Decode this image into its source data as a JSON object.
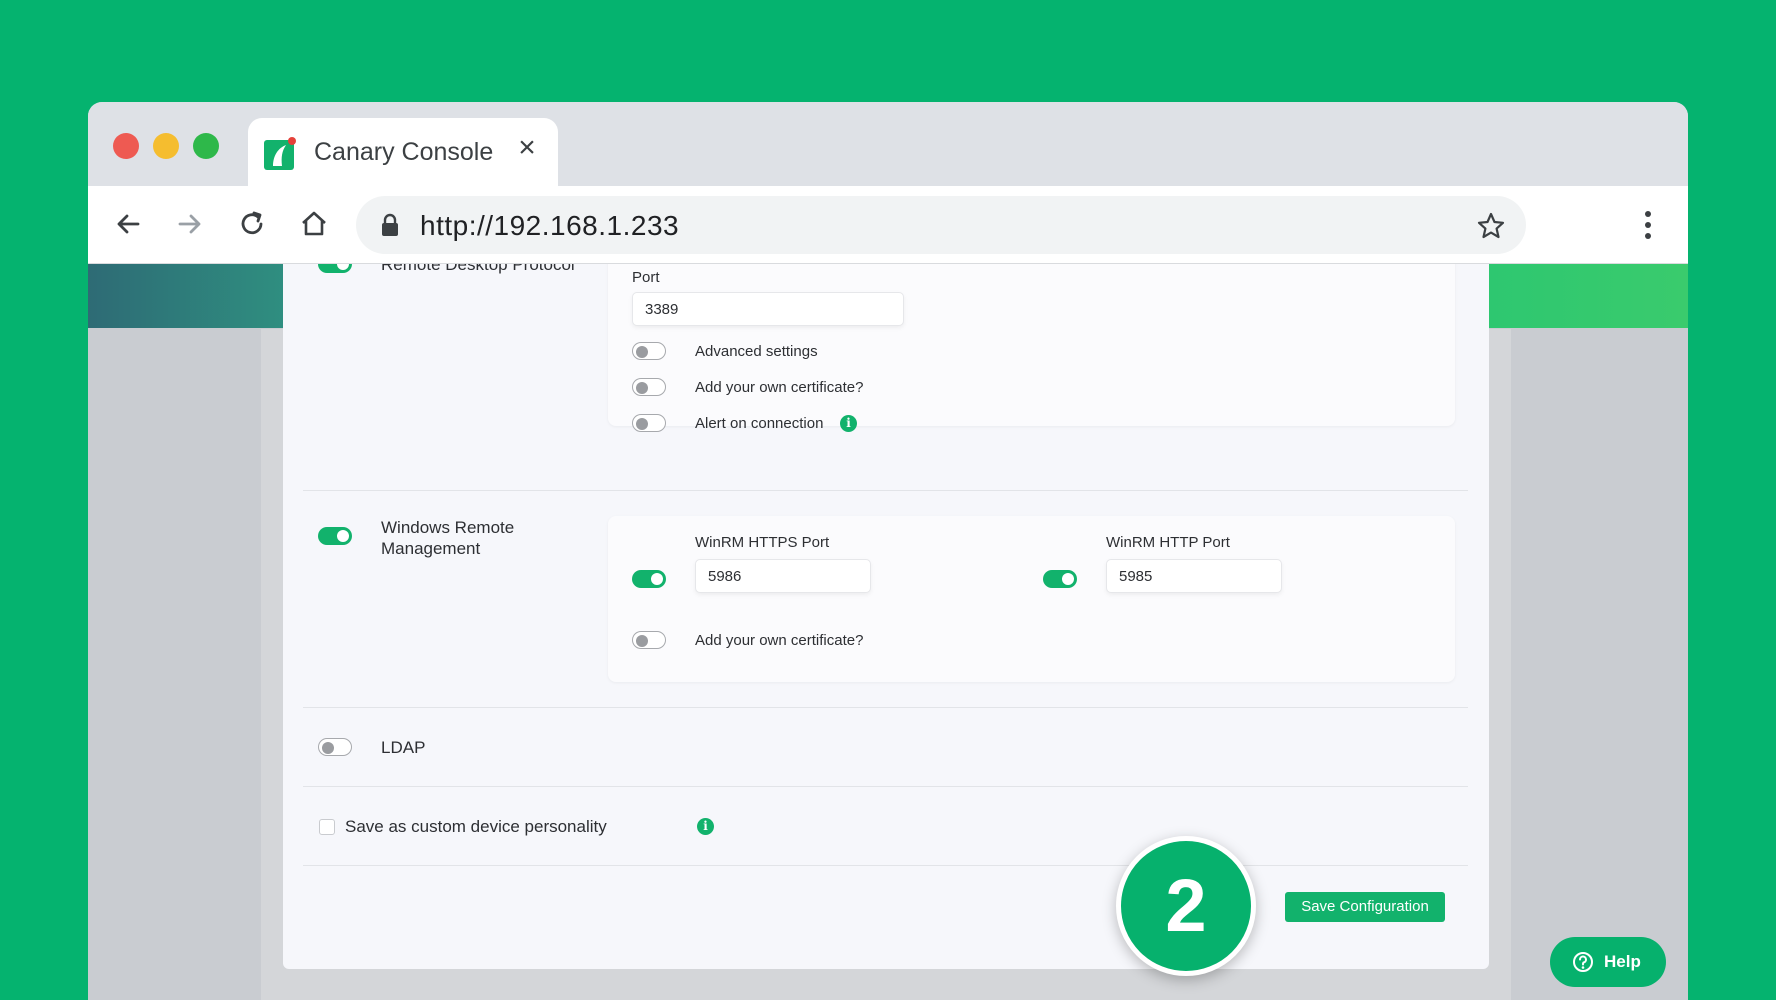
{
  "browser": {
    "tab_title": "Canary Console",
    "url": "http://192.168.1.233"
  },
  "rdp": {
    "label": "Remote Desktop Protocol",
    "enabled": true,
    "port_label": "Port",
    "port_value": "3389",
    "advanced_label": "Advanced settings",
    "certificate_label": "Add your own certificate?",
    "alert_label": "Alert on connection"
  },
  "winrm": {
    "label": "Windows Remote Management",
    "enabled": true,
    "https_port_label": "WinRM HTTPS Port",
    "https_port_value": "5986",
    "http_port_label": "WinRM HTTP Port",
    "http_port_value": "5985",
    "certificate_label": "Add your own certificate?"
  },
  "ldap": {
    "label": "LDAP",
    "enabled": false
  },
  "personality": {
    "label": "Save as custom device personality"
  },
  "actions": {
    "save_label": "Save Configuration"
  },
  "overlay": {
    "step_number": "2",
    "help_label": "Help"
  },
  "colors": {
    "background": "#05b36f",
    "accent": "#12b26c"
  }
}
